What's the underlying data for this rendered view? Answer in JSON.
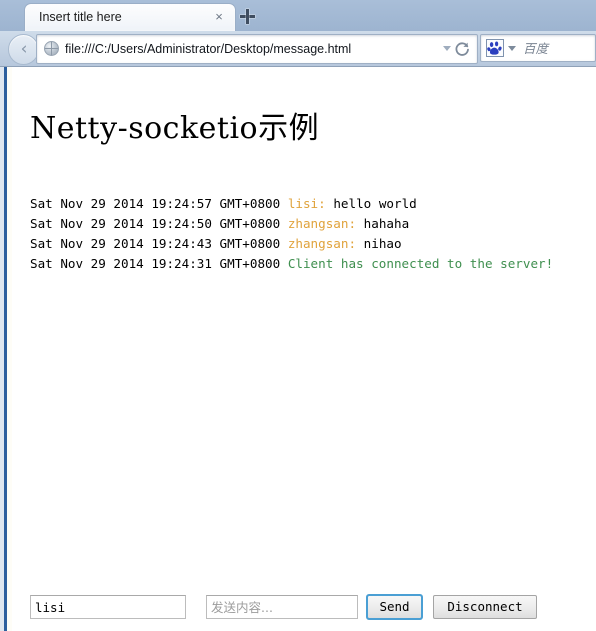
{
  "browser": {
    "tab": {
      "title": "Insert title here",
      "close_label": "×"
    },
    "new_tab_label": "+",
    "back_arrow_glyph": "‹",
    "address_bar": {
      "url": "file:///C:/Users/Administrator/Desktop/message.html",
      "site_icon": "globe-icon",
      "dropdown_icon": "chevron-down-icon",
      "reload_icon": "reload-icon"
    },
    "search_bar": {
      "engine_icon": "baidu-paw-icon",
      "engine_dropdown_icon": "chevron-down-icon",
      "engine_label": "百度"
    }
  },
  "page": {
    "title": "Netty-socketio示例",
    "messages": [
      {
        "timestamp": "Sat Nov 29 2014 19:24:57 GMT+0800",
        "user": "lisi:",
        "body": "hello world",
        "system": ""
      },
      {
        "timestamp": "Sat Nov 29 2014 19:24:50 GMT+0800",
        "user": "zhangsan:",
        "body": "hahaha",
        "system": ""
      },
      {
        "timestamp": "Sat Nov 29 2014 19:24:43 GMT+0800",
        "user": "zhangsan:",
        "body": "nihao",
        "system": ""
      },
      {
        "timestamp": "Sat Nov 29 2014 19:24:31 GMT+0800",
        "user": "",
        "body": "",
        "system": "Client has connected to the server!"
      }
    ],
    "controls": {
      "nickname_value": "lisi",
      "nickname_placeholder": "",
      "message_value": "",
      "message_placeholder": "发送内容...",
      "send_label": "Send",
      "disconnect_label": "Disconnect"
    }
  },
  "colors": {
    "username": "#e0a33c",
    "system_message": "#3f8f4f",
    "focus_ring": "#4a9fd4",
    "chrome": "#a9bdd6"
  }
}
